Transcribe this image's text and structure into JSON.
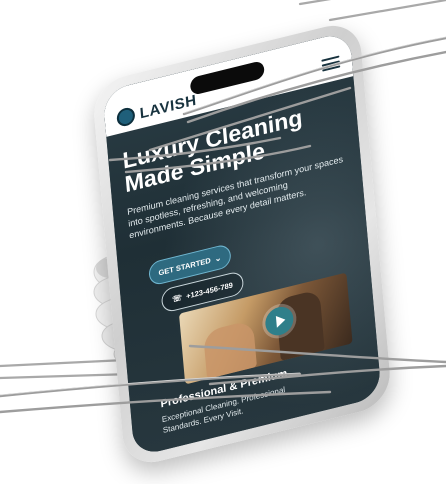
{
  "brand": {
    "logo_text": "LAVISH"
  },
  "hero": {
    "title": "Luxury Cleaning Made Simple",
    "subtitle": "Premium cleaning services that transform your spaces into spotless, refreshing, and welcoming environments. Because every detail matters."
  },
  "actions": {
    "get_started_label": "GET STARTED",
    "phone_label": "+123-456-789"
  },
  "feature": {
    "title": "Professional & Premium",
    "body": "Exceptional Cleaning. Professional Standards. Every Visit."
  },
  "icons": {
    "logo": "logo-icon",
    "menu": "menu-icon",
    "phone": "phone-icon",
    "play": "play-icon",
    "chevron": "chevron-down-icon"
  },
  "colors": {
    "screen_background": "#23343b",
    "primary_button": "#2e6a80",
    "brand_text": "#17323e",
    "play_button": "#2f7f8a"
  }
}
